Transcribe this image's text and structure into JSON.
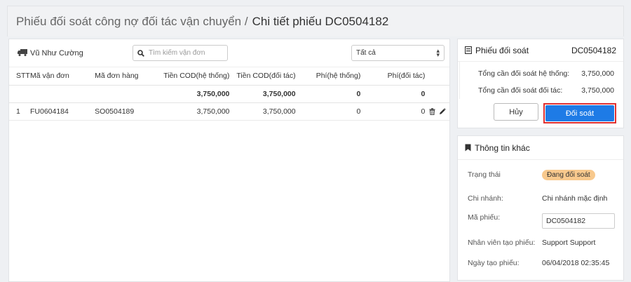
{
  "breadcrumb": {
    "parent": "Phiếu đối soát công nợ đối tác vận chuyển /",
    "current": "Chi tiết phiếu DC0504182"
  },
  "toolbar": {
    "carrier_name": "Vũ Như Cường",
    "search_placeholder": "Tìm kiếm vận đơn",
    "filter_selected": "Tất cả"
  },
  "table": {
    "headers": {
      "stt": "STT",
      "van_don": "Mã vận đơn",
      "don_hang": "Mã đơn hàng",
      "cod_system": "Tiền COD(hệ thống)",
      "cod_partner": "Tiền COD(đối tác)",
      "fee_system": "Phí(hệ thống)",
      "fee_partner": "Phí(đối tác)"
    },
    "totals": {
      "cod_system": "3,750,000",
      "cod_partner": "3,750,000",
      "fee_system": "0",
      "fee_partner": "0"
    },
    "rows": [
      {
        "stt": "1",
        "van_don": "FU0604184",
        "don_hang": "SO0504189",
        "cod_system": "3,750,000",
        "cod_partner": "3,750,000",
        "fee_system": "0",
        "fee_partner": "0"
      }
    ]
  },
  "summary": {
    "title": "Phiếu đối soát",
    "code": "DC0504182",
    "system_label": "Tổng cần đối soát hệ thống:",
    "system_value": "3,750,000",
    "partner_label": "Tổng cần đối soát đối tác:",
    "partner_value": "3,750,000",
    "cancel_label": "Hủy",
    "confirm_label": "Đối soát"
  },
  "info": {
    "title": "Thông tin khác",
    "status_label": "Trạng thái",
    "status_value": "Đang đối soát",
    "branch_label": "Chi nhánh:",
    "branch_value": "Chi nhánh mặc định",
    "code_label": "Mã phiếu:",
    "code_value": "DC0504182",
    "creator_label": "Nhân viên tạo phiếu:",
    "creator_value": "Support Support",
    "date_label": "Ngày tạo phiếu:",
    "date_value": "06/04/2018 02:35:45"
  },
  "colors": {
    "accent": "#1e7be6",
    "highlight": "#e03030",
    "badge": "#f8c98d"
  }
}
